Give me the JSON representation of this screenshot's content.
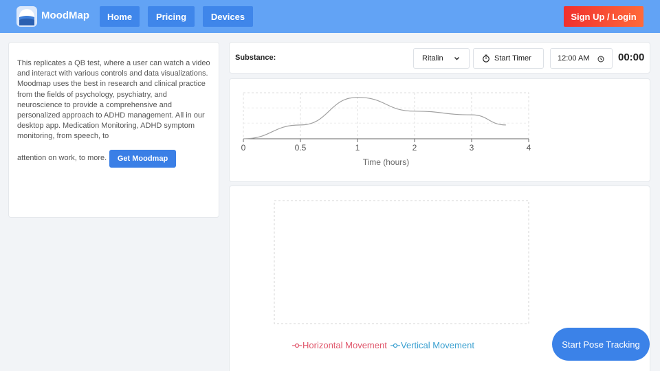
{
  "header": {
    "brand": "MoodMap",
    "nav": [
      {
        "label": "Home"
      },
      {
        "label": "Pricing"
      },
      {
        "label": "Devices"
      }
    ],
    "signup_label": "Sign Up / Login"
  },
  "info": {
    "text": "This replicates a QB test, where a user can watch a video and interact with various controls and data visualizations. Moodmap uses the best in research and clinical practice from the fields of psychology, psychiatry, and neuroscience to provide a comprehensive and personalized approach to ADHD management. All in our desktop app. Medication Monitoring, ADHD symptom monitoring, from speech, to",
    "text_end": "attention on work, to more.",
    "cta_label": "Get Moodmap"
  },
  "controls": {
    "substance_label": "Substance:",
    "substance_value": "Ritalin",
    "start_timer_label": "Start Timer",
    "time_value": "12:00 AM",
    "timer_display": "00:00"
  },
  "chart_data": [
    {
      "type": "line",
      "title": "",
      "xlabel": "Time (hours)",
      "ylabel": "",
      "xlim": [
        0,
        4
      ],
      "x_ticks": [
        "0",
        "0.5",
        "1",
        "2",
        "3",
        "4"
      ],
      "grid": true,
      "series": [
        {
          "x": [
            "0",
            "0.5",
            "1",
            "2",
            "3",
            "3.6"
          ],
          "values": [
            0,
            0.3,
            0.9,
            0.6,
            0.52,
            0.3
          ],
          "color": "#a0a0a0"
        }
      ]
    },
    {
      "type": "line",
      "title": "",
      "grid": true,
      "legend": "bottom",
      "series": [
        {
          "name": "Horizontal Movement",
          "values": [],
          "color": "#e0566b"
        },
        {
          "name": "Vertical Movement",
          "values": [],
          "color": "#3aa0d0"
        }
      ]
    }
  ],
  "pose_button_label": "Start Pose Tracking"
}
